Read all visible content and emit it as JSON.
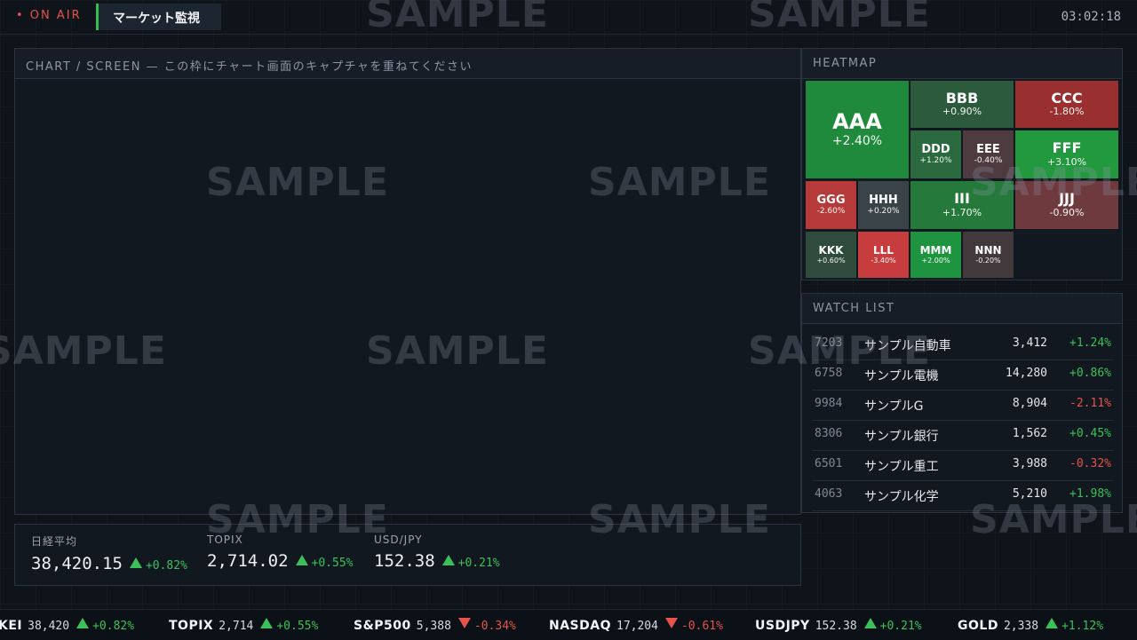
{
  "header": {
    "on_air": "• ON AIR",
    "title": "マーケット監視",
    "clock": "03:02:18"
  },
  "chart_panel": {
    "title": "CHART / SCREEN — この枠にチャート画面のキャプチャを重ねてください"
  },
  "heatmap": {
    "title": "HEATMAP",
    "cells": [
      {
        "sym": "AAA",
        "pct": "+2.40%",
        "color": "#1f8a3c"
      },
      {
        "sym": "BBB",
        "pct": "+0.90%",
        "color": "#2b5a3d"
      },
      {
        "sym": "CCC",
        "pct": "-1.80%",
        "color": "#9a2f2f"
      },
      {
        "sym": "DDD",
        "pct": "+1.20%",
        "color": "#2a6a3e"
      },
      {
        "sym": "EEE",
        "pct": "-0.40%",
        "color": "#4e3b3f"
      },
      {
        "sym": "FFF",
        "pct": "+3.10%",
        "color": "#23993f"
      },
      {
        "sym": "GGG",
        "pct": "-2.60%",
        "color": "#b63a3a"
      },
      {
        "sym": "HHH",
        "pct": "+0.20%",
        "color": "#3a4347"
      },
      {
        "sym": "III",
        "pct": "+1.70%",
        "color": "#257a3b"
      },
      {
        "sym": "JJJ",
        "pct": "-0.90%",
        "color": "#6e3a3d"
      },
      {
        "sym": "KKK",
        "pct": "+0.60%",
        "color": "#2e4b3c"
      },
      {
        "sym": "LLL",
        "pct": "-3.40%",
        "color": "#c73d3d"
      },
      {
        "sym": "MMM",
        "pct": "+2.00%",
        "color": "#1f9440"
      },
      {
        "sym": "NNN",
        "pct": "-0.20%",
        "color": "#42393d"
      }
    ]
  },
  "watchlist": {
    "title": "WATCH LIST",
    "rows": [
      {
        "code": "7203",
        "name": "サンプル自動車",
        "price": "3,412",
        "change": "+1.24%",
        "dir": "up"
      },
      {
        "code": "6758",
        "name": "サンプル電機",
        "price": "14,280",
        "change": "+0.86%",
        "dir": "up"
      },
      {
        "code": "9984",
        "name": "サンプルG",
        "price": "8,904",
        "change": "-2.11%",
        "dir": "down"
      },
      {
        "code": "8306",
        "name": "サンプル銀行",
        "price": "1,562",
        "change": "+0.45%",
        "dir": "up"
      },
      {
        "code": "6501",
        "name": "サンプル重工",
        "price": "3,988",
        "change": "-0.32%",
        "dir": "down"
      },
      {
        "code": "4063",
        "name": "サンプル化学",
        "price": "5,210",
        "change": "+1.98%",
        "dir": "up"
      }
    ]
  },
  "indices": [
    {
      "label": "日経平均",
      "value": "38,420.15",
      "change": "+0.82%",
      "dir": "up"
    },
    {
      "label": "TOPIX",
      "value": "2,714.02",
      "change": "+0.55%",
      "dir": "up"
    },
    {
      "label": "USD/JPY",
      "value": "152.38",
      "change": "+0.21%",
      "dir": "up"
    }
  ],
  "ticker": [
    {
      "sym": "KEI",
      "value": "38,420",
      "change": "+0.82%",
      "dir": "up"
    },
    {
      "sym": "TOPIX",
      "value": "2,714",
      "change": "+0.55%",
      "dir": "up"
    },
    {
      "sym": "S&P500",
      "value": "5,388",
      "change": "-0.34%",
      "dir": "down"
    },
    {
      "sym": "NASDAQ",
      "value": "17,204",
      "change": "-0.61%",
      "dir": "down"
    },
    {
      "sym": "USDJPY",
      "value": "152.38",
      "change": "+0.21%",
      "dir": "up"
    },
    {
      "sym": "GOLD",
      "value": "2,338",
      "change": "+1.12%",
      "dir": "up"
    }
  ],
  "watermark": "SAMPLE"
}
